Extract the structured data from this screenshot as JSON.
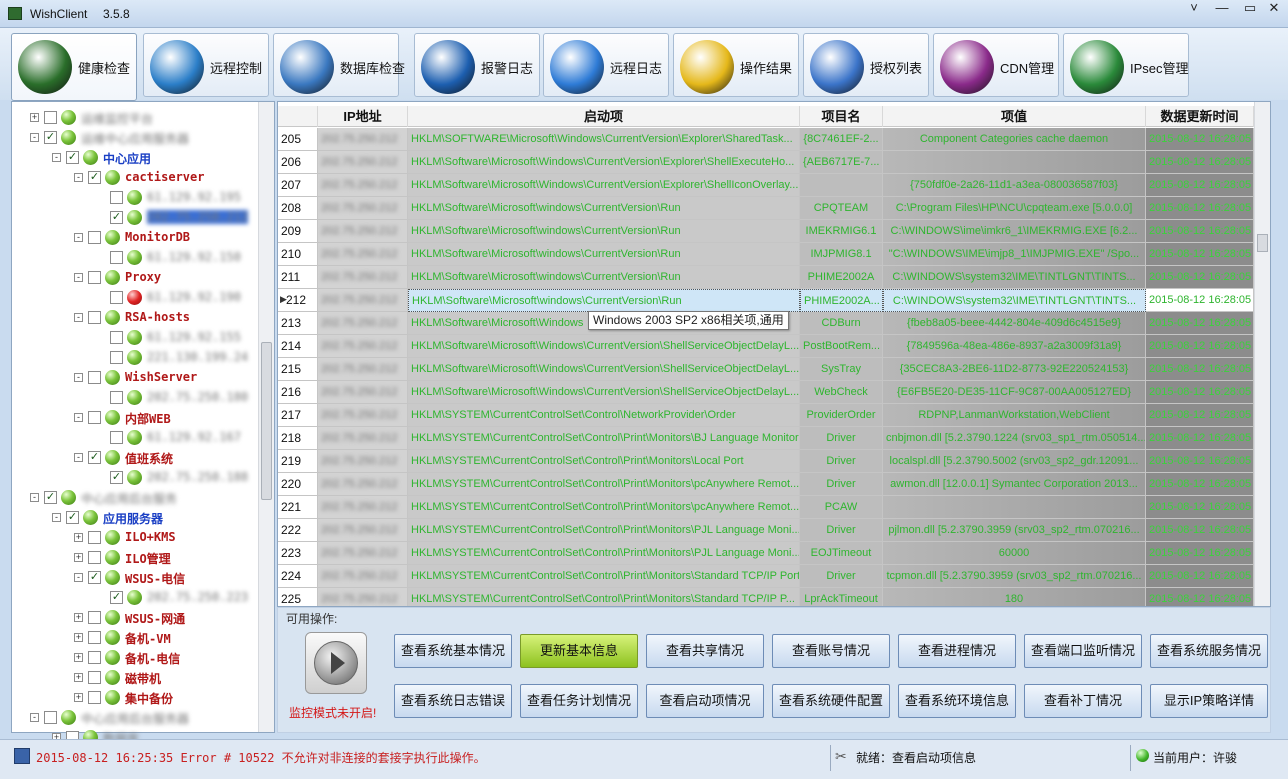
{
  "window": {
    "title": "WishClient",
    "version": "3.5.8",
    "controls": [
      "˅",
      "—",
      "▭",
      "✕"
    ]
  },
  "tabs": [
    {
      "label": "健康检查",
      "icon": "health-check-icon",
      "color": "#2a6e2a",
      "active": true
    },
    {
      "label": "远程控制",
      "icon": "globe-icon",
      "color": "#2b7ec8"
    },
    {
      "label": "数据库检查",
      "icon": "database-icon",
      "color": "#3a78c0"
    },
    {
      "label": "报警日志",
      "icon": "megaphone-icon",
      "color": "#1d5fb0"
    },
    {
      "label": "远程日志",
      "icon": "wrench-icon",
      "color": "#2e7bd6"
    },
    {
      "label": "操作结果",
      "icon": "hourglass-icon",
      "color": "#e5b81a"
    },
    {
      "label": "授权列表",
      "icon": "shield-icon",
      "color": "#3b74c9"
    },
    {
      "label": "CDN管理",
      "icon": "yin-yang-purple-icon",
      "color": "#8a2a8a"
    },
    {
      "label": "IPsec管理",
      "icon": "yin-yang-green-icon",
      "color": "#2a8a3a"
    }
  ],
  "tree": [
    {
      "label": "运维监控平台",
      "level": 0,
      "blur": true,
      "checked": false,
      "expander": "+",
      "red": false
    },
    {
      "label": "运维中心应用服务器",
      "level": 0,
      "blur": true,
      "checked": true,
      "expander": "-",
      "red": false
    },
    {
      "label": "中心应用",
      "level": 1,
      "blur": false,
      "checked": true,
      "expander": "-",
      "color": "#1a3fc4"
    },
    {
      "label": "cactiserver",
      "level": 2,
      "blur": false,
      "checked": true,
      "expander": "-",
      "color": "#b01818"
    },
    {
      "label": "61.129.92.195",
      "level": 3,
      "blur": true,
      "checked": false,
      "expander": "",
      "red": false
    },
    {
      "label": "202.75.250.212",
      "level": 3,
      "blur": true,
      "checked": true,
      "expander": "",
      "red": false,
      "selected": true
    },
    {
      "label": "MonitorDB",
      "level": 2,
      "blur": false,
      "checked": false,
      "expander": "-",
      "color": "#b01818"
    },
    {
      "label": "61.129.92.150",
      "level": 3,
      "blur": true,
      "checked": false,
      "expander": "",
      "red": false
    },
    {
      "label": "Proxy",
      "level": 2,
      "blur": false,
      "checked": false,
      "expander": "-",
      "color": "#b01818"
    },
    {
      "label": "61.129.92.190",
      "level": 3,
      "blur": true,
      "checked": false,
      "expander": "",
      "red": true
    },
    {
      "label": "RSA-hosts",
      "level": 2,
      "blur": false,
      "checked": false,
      "expander": "-",
      "color": "#b01818"
    },
    {
      "label": "61.129.92.155",
      "level": 3,
      "blur": true,
      "checked": false,
      "expander": "",
      "red": false
    },
    {
      "label": "221.130.199.24",
      "level": 3,
      "blur": true,
      "checked": false,
      "expander": "",
      "red": false
    },
    {
      "label": "WishServer",
      "level": 2,
      "blur": false,
      "checked": false,
      "expander": "-",
      "color": "#b01818"
    },
    {
      "label": "202.75.250.180",
      "level": 3,
      "blur": true,
      "checked": false,
      "expander": "",
      "red": false
    },
    {
      "label": "内部WEB",
      "level": 2,
      "blur": false,
      "checked": false,
      "expander": "-",
      "color": "#b01818"
    },
    {
      "label": "61.129.92.167",
      "level": 3,
      "blur": true,
      "checked": false,
      "expander": "",
      "red": false
    },
    {
      "label": "值班系统",
      "level": 2,
      "blur": false,
      "checked": true,
      "expander": "-",
      "color": "#b01818"
    },
    {
      "label": "202.75.250.188",
      "level": 3,
      "blur": true,
      "checked": true,
      "expander": "",
      "red": false
    },
    {
      "label": "中心应用后台服务",
      "level": 0,
      "blur": true,
      "checked": true,
      "expander": "-",
      "red": false
    },
    {
      "label": "应用服务器",
      "level": 1,
      "blur": false,
      "checked": true,
      "expander": "-",
      "color": "#1a3fc4"
    },
    {
      "label": "ILO+KMS",
      "level": 2,
      "blur": false,
      "checked": false,
      "expander": "+",
      "color": "#b01818"
    },
    {
      "label": "ILO管理",
      "level": 2,
      "blur": false,
      "checked": false,
      "expander": "+",
      "color": "#b01818"
    },
    {
      "label": "WSUS-电信",
      "level": 2,
      "blur": false,
      "checked": true,
      "expander": "-",
      "color": "#b01818"
    },
    {
      "label": "202.75.250.223",
      "level": 3,
      "blur": true,
      "checked": true,
      "expander": "",
      "red": false
    },
    {
      "label": "WSUS-网通",
      "level": 2,
      "blur": false,
      "checked": false,
      "expander": "+",
      "color": "#b01818"
    },
    {
      "label": "备机-VM",
      "level": 2,
      "blur": false,
      "checked": false,
      "expander": "+",
      "color": "#b01818"
    },
    {
      "label": "备机-电信",
      "level": 2,
      "blur": false,
      "checked": false,
      "expander": "+",
      "color": "#b01818"
    },
    {
      "label": "磁带机",
      "level": 2,
      "blur": false,
      "checked": false,
      "expander": "+",
      "color": "#b01818"
    },
    {
      "label": "集中备份",
      "level": 2,
      "blur": false,
      "checked": false,
      "expander": "+",
      "color": "#b01818"
    },
    {
      "label": "中心应用后台服务器",
      "level": 0,
      "blur": true,
      "checked": false,
      "expander": "-",
      "red": false
    },
    {
      "label": "数据库",
      "level": 1,
      "blur": true,
      "checked": false,
      "expander": "+",
      "red": false
    }
  ],
  "grid": {
    "columns": [
      "",
      "IP地址",
      "启动项",
      "项目名",
      "项值",
      "数据更新时间"
    ],
    "selected_row_index": 7,
    "rows": [
      {
        "num": "205",
        "ip": "202.75.250.212",
        "start": "HKLM\\SOFTWARE\\Microsoft\\Windows\\CurrentVersion\\Explorer\\SharedTask...",
        "item": "{8C7461EF-2...",
        "value": "Component Categories cache daemon",
        "time": "2015-08-12 16:28:05"
      },
      {
        "num": "206",
        "ip": "202.75.250.212",
        "start": "HKLM\\Software\\Microsoft\\Windows\\CurrentVersion\\Explorer\\ShellExecuteHo...",
        "item": "{AEB6717E-7...",
        "value": "",
        "time": "2015-08-12 16:28:05"
      },
      {
        "num": "207",
        "ip": "202.75.250.212",
        "start": "HKLM\\Software\\Microsoft\\Windows\\CurrentVersion\\Explorer\\ShellIconOverlay...",
        "item": "",
        "value": "{750fdf0e-2a26-11d1-a3ea-080036587f03}",
        "time": "2015-08-12 16:28:05"
      },
      {
        "num": "208",
        "ip": "202.75.250.212",
        "start": "HKLM\\Software\\Microsoft\\windows\\CurrentVersion\\Run",
        "item": "CPQTEAM",
        "value": "C:\\Program Files\\HP\\NCU\\cpqteam.exe [5.0.0.0]",
        "time": "2015-08-12 16:28:05"
      },
      {
        "num": "209",
        "ip": "202.75.250.212",
        "start": "HKLM\\Software\\Microsoft\\windows\\CurrentVersion\\Run",
        "item": "IMEKRMIG6.1",
        "value": "C:\\WINDOWS\\ime\\imkr6_1\\IMEKRMIG.EXE [6.2...",
        "time": "2015-08-12 16:28:05"
      },
      {
        "num": "210",
        "ip": "202.75.250.212",
        "start": "HKLM\\Software\\Microsoft\\windows\\CurrentVersion\\Run",
        "item": "IMJPMIG8.1",
        "value": "\"C:\\WINDOWS\\IME\\imjp8_1\\IMJPMIG.EXE\" /Spo...",
        "time": "2015-08-12 16:28:05"
      },
      {
        "num": "211",
        "ip": "202.75.250.212",
        "start": "HKLM\\Software\\Microsoft\\windows\\CurrentVersion\\Run",
        "item": "PHIME2002A",
        "value": "C:\\WINDOWS\\system32\\IME\\TINTLGNT\\TINTS...",
        "time": "2015-08-12 16:28:05"
      },
      {
        "num": "212",
        "ip": "202.75.250.212",
        "start": "HKLM\\Software\\Microsoft\\windows\\CurrentVersion\\Run",
        "item": "PHIME2002A...",
        "value": "C:\\WINDOWS\\system32\\IME\\TINTLGNT\\TINTS...",
        "time": "2015-08-12 16:28:05"
      },
      {
        "num": "213",
        "ip": "202.75.250.212",
        "start": "HKLM\\Software\\Microsoft\\Windows",
        "item": "CDBurn",
        "value": "{fbeb8a05-beee-4442-804e-409d6c4515e9}",
        "time": "2015-08-12 16:28:05"
      },
      {
        "num": "214",
        "ip": "202.75.250.212",
        "start": "HKLM\\Software\\Microsoft\\Windows\\CurrentVersion\\ShellServiceObjectDelayL...",
        "item": "PostBootRem...",
        "value": "{7849596a-48ea-486e-8937-a2a3009f31a9}",
        "time": "2015-08-12 16:28:05"
      },
      {
        "num": "215",
        "ip": "202.75.250.212",
        "start": "HKLM\\Software\\Microsoft\\Windows\\CurrentVersion\\ShellServiceObjectDelayL...",
        "item": "SysTray",
        "value": "{35CEC8A3-2BE6-11D2-8773-92E220524153}",
        "time": "2015-08-12 16:28:05"
      },
      {
        "num": "216",
        "ip": "202.75.250.212",
        "start": "HKLM\\Software\\Microsoft\\Windows\\CurrentVersion\\ShellServiceObjectDelayL...",
        "item": "WebCheck",
        "value": "{E6FB5E20-DE35-11CF-9C87-00AA005127ED}",
        "time": "2015-08-12 16:28:05"
      },
      {
        "num": "217",
        "ip": "202.75.250.212",
        "start": "HKLM\\SYSTEM\\CurrentControlSet\\Control\\NetworkProvider\\Order",
        "item": "ProviderOrder",
        "value": "RDPNP,LanmanWorkstation,WebClient",
        "time": "2015-08-12 16:28:05"
      },
      {
        "num": "218",
        "ip": "202.75.250.212",
        "start": "HKLM\\SYSTEM\\CurrentControlSet\\Control\\Print\\Monitors\\BJ Language Monitor",
        "item": "Driver",
        "value": "cnbjmon.dll [5.2.3790.1224 (srv03_sp1_rtm.050514...",
        "time": "2015-08-12 16:28:05"
      },
      {
        "num": "219",
        "ip": "202.75.250.212",
        "start": "HKLM\\SYSTEM\\CurrentControlSet\\Control\\Print\\Monitors\\Local Port",
        "item": "Driver",
        "value": "localspl.dll [5.2.3790.5002 (srv03_sp2_gdr.12091...",
        "time": "2015-08-12 16:28:05"
      },
      {
        "num": "220",
        "ip": "202.75.250.212",
        "start": "HKLM\\SYSTEM\\CurrentControlSet\\Control\\Print\\Monitors\\pcAnywhere Remot...",
        "item": "Driver",
        "value": "awmon.dll [12.0.0.1] Symantec Corporation 2013...",
        "time": "2015-08-12 16:28:05"
      },
      {
        "num": "221",
        "ip": "202.75.250.212",
        "start": "HKLM\\SYSTEM\\CurrentControlSet\\Control\\Print\\Monitors\\pcAnywhere Remot...",
        "item": "PCAW",
        "value": "",
        "time": "2015-08-12 16:28:05"
      },
      {
        "num": "222",
        "ip": "202.75.250.212",
        "start": "HKLM\\SYSTEM\\CurrentControlSet\\Control\\Print\\Monitors\\PJL Language Moni...",
        "item": "Driver",
        "value": "pjlmon.dll [5.2.3790.3959 (srv03_sp2_rtm.070216...",
        "time": "2015-08-12 16:28:05"
      },
      {
        "num": "223",
        "ip": "202.75.250.212",
        "start": "HKLM\\SYSTEM\\CurrentControlSet\\Control\\Print\\Monitors\\PJL Language Moni...",
        "item": "EOJTimeout",
        "value": "60000",
        "time": "2015-08-12 16:28:05"
      },
      {
        "num": "224",
        "ip": "202.75.250.212",
        "start": "HKLM\\SYSTEM\\CurrentControlSet\\Control\\Print\\Monitors\\Standard TCP/IP Port",
        "item": "Driver",
        "value": "tcpmon.dll [5.2.3790.3959 (srv03_sp2_rtm.070216...",
        "time": "2015-08-12 16:28:05"
      },
      {
        "num": "225",
        "ip": "202.75.250.212",
        "start": "HKLM\\SYSTEM\\CurrentControlSet\\Control\\Print\\Monitors\\Standard TCP/IP P...",
        "item": "LprAckTimeout",
        "value": "180",
        "time": "2015-08-12 16:28:05"
      }
    ]
  },
  "tooltip": "Windows 2003 SP2 x86相关项,通用",
  "ops": {
    "label": "可用操作:",
    "monitor_status": "监控模式未开启!",
    "row1": [
      "查看系统基本情况",
      "更新基本信息",
      "查看共享情况",
      "查看账号情况",
      "查看进程情况",
      "查看端口监听情况",
      "查看系统服务情况"
    ],
    "row2": [
      "查看系统日志错误",
      "查看任务计划情况",
      "查看启动项情况",
      "查看系统硬件配置",
      "查看系统环境信息",
      "查看补丁情况",
      "显示IP策略详情"
    ],
    "highlighted": "更新基本信息"
  },
  "status": {
    "error": "2015-08-12 16:25:35   Error # 10522  不允许对非连接的套接字执行此操作。",
    "ready": "就绪：查看启动项信息",
    "user": "当前用户：许骏"
  }
}
